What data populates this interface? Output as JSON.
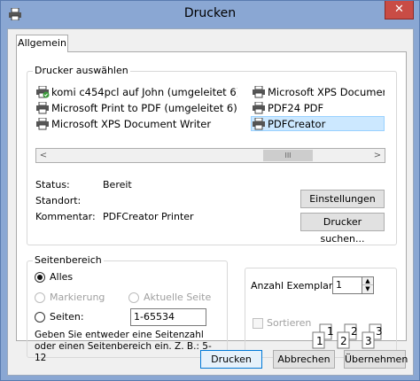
{
  "window": {
    "title": "Drucken",
    "close_label": "✕"
  },
  "tabs": [
    {
      "label": "Allgemein"
    }
  ],
  "printer_group": {
    "label": "Drucker auswählen",
    "printers": [
      {
        "name": "komi c454pcl auf John (umgeleitet 6)",
        "selected": false
      },
      {
        "name": "Microsoft Print to PDF (umgeleitet 6)",
        "selected": false
      },
      {
        "name": "Microsoft XPS Document Writer",
        "selected": false
      },
      {
        "name": "Microsoft XPS Document",
        "selected": false
      },
      {
        "name": "PDF24 PDF",
        "selected": false
      },
      {
        "name": "PDFCreator",
        "selected": true
      }
    ],
    "scroll_left": "<",
    "scroll_right": ">",
    "thumb_grip": "III",
    "status_label": "Status:",
    "status_value": "Bereit",
    "location_label": "Standort:",
    "location_value": "",
    "comment_label": "Kommentar:",
    "comment_value": "PDFCreator Printer",
    "settings_button": "Einstellungen",
    "find_printer_button": "Drucker suchen..."
  },
  "page_range": {
    "label": "Seitenbereich",
    "all_label": "Alles",
    "selection_label": "Markierung",
    "current_page_label": "Aktuelle Seite",
    "pages_label": "Seiten:",
    "pages_value": "1-65534",
    "hint": "Geben Sie entweder eine Seitenzahl oder einen Seitenbereich ein. Z. B.: 5-12",
    "selected": "all"
  },
  "copies": {
    "label": "Anzahl Exemplare:",
    "value": "1",
    "collate_label": "Sortieren",
    "collate_checked": false,
    "page_numbers": [
      "1",
      "1",
      "2",
      "2",
      "3",
      "3"
    ]
  },
  "footer": {
    "print_button": "Drucken",
    "cancel_button": "Abbrechen",
    "apply_button": "Übernehmen"
  },
  "colors": {
    "selection": "#cce8ff",
    "default_button_border": "#0078d7",
    "close_button": "#c94c45"
  }
}
